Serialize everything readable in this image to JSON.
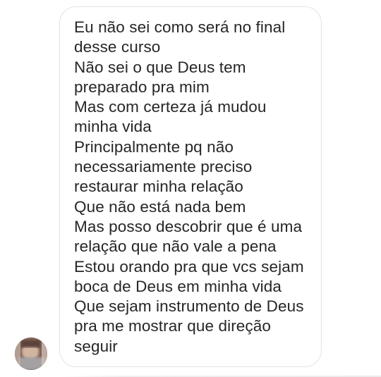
{
  "message": {
    "lines": [
      "Eu não sei como será no final",
      "desse curso",
      "Não sei o que Deus tem",
      "preparado pra mim",
      "Mas com certeza já mudou",
      "minha vida",
      "Principalmente pq não",
      "necessariamente preciso",
      "restaurar minha relação",
      "Que não está nada bem",
      "Mas posso descobrir que é uma",
      "relação que não vale a pena",
      "Estou orando pra que vcs sejam",
      "boca de Deus em minha vida",
      "Que sejam instrumento de Deus",
      "pra me mostrar que direção",
      "seguir"
    ]
  },
  "colors": {
    "background": "#ffffff",
    "bubble_border": "#e3e3e3",
    "text": "#262626"
  },
  "sender": {
    "avatar_icon": "blurred-profile-photo"
  }
}
